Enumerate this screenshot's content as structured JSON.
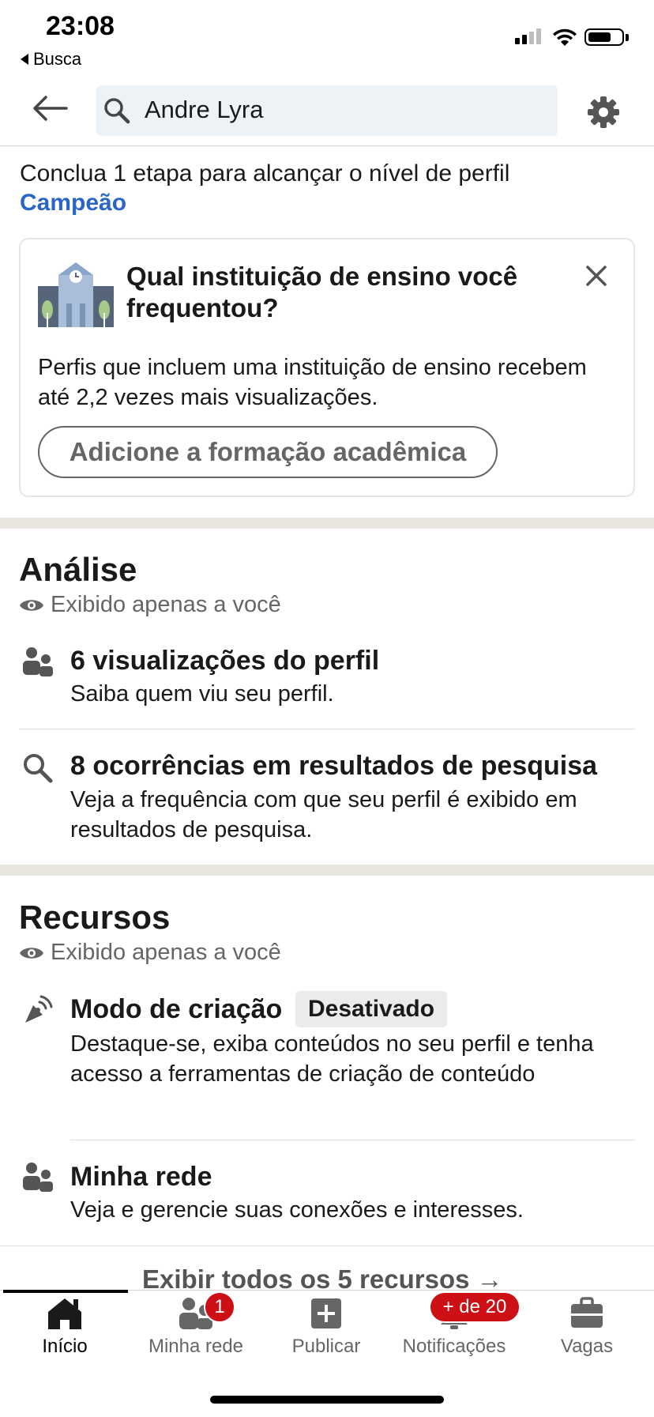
{
  "status_bar": {
    "time": "23:08",
    "back_app_label": "Busca"
  },
  "header": {
    "search_value": "Andre Lyra"
  },
  "completion": {
    "text": "Conclua 1 etapa para alcançar o nível de perfil",
    "level": "Campeão"
  },
  "edu_card": {
    "title": "Qual instituição de ensino você frequentou?",
    "description": "Perfis que incluem uma instituição de ensino recebem até 2,2 vezes mais visualizações.",
    "button_label": "Adicione a formação acadêmica"
  },
  "analysis": {
    "title": "Análise",
    "visibility": "Exibido apenas a você",
    "items": [
      {
        "title": "6 visualizações do perfil",
        "subtitle": "Saiba quem viu seu perfil.",
        "icon": "people-icon"
      },
      {
        "title": "8 ocorrências em resultados de pesquisa",
        "subtitle": "Veja a frequência com que seu perfil é exibido em resultados de pesquisa.",
        "icon": "search-icon"
      }
    ]
  },
  "resources": {
    "title": "Recursos",
    "visibility": "Exibido apenas a você",
    "items": [
      {
        "title": "Modo de criação",
        "badge": "Desativado",
        "subtitle": "Destaque-se, exiba conteúdos no seu perfil e tenha acesso a ferramentas de criação de conteúdo",
        "icon": "broadcast-icon"
      },
      {
        "title": "Minha rede",
        "subtitle": "Veja e gerencie suas conexões e interesses.",
        "icon": "people-icon"
      }
    ],
    "show_all": "Exibir todos os 5 recursos →"
  },
  "bottom_nav": {
    "items": [
      {
        "label": "Início",
        "icon": "home-icon",
        "active": true
      },
      {
        "label": "Minha rede",
        "icon": "network-icon",
        "badge": "1"
      },
      {
        "label": "Publicar",
        "icon": "post-icon"
      },
      {
        "label": "Notificações",
        "icon": "bell-icon",
        "badge": "+ de 20"
      },
      {
        "label": "Vagas",
        "icon": "briefcase-icon"
      }
    ]
  },
  "colors": {
    "link": "#2a66c6",
    "badge": "#cc1016",
    "divider": "#e9e5df"
  }
}
